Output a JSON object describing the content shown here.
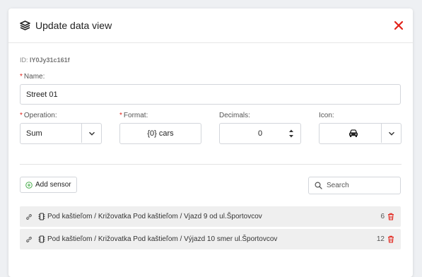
{
  "dialog": {
    "title": "Update data view",
    "id_label": "ID:",
    "id_value": "IY0Jy31c161f"
  },
  "form": {
    "name": {
      "label": "Name:",
      "required": "*",
      "value": "Street 01"
    },
    "operation": {
      "label": "Operation:",
      "required": "*",
      "value": "Sum"
    },
    "format": {
      "label": "Format:",
      "required": "*",
      "value": "{0} cars"
    },
    "decimals": {
      "label": "Decimals:",
      "value": "0"
    },
    "icon": {
      "label": "Icon:",
      "value_icon": "car-icon"
    }
  },
  "sensors_toolbar": {
    "add_label": "Add sensor",
    "search_placeholder": "Search"
  },
  "sensors": [
    {
      "name": "Pod kaštieľom / Križovatka Pod kaštieľom / Vjazd 9 od ul.Športovcov",
      "count": "6"
    },
    {
      "name": "Pod kaštieľom / Križovatka Pod kaštieľom / Výjazd 10 smer ul.Športovcov",
      "count": "12"
    }
  ],
  "colors": {
    "accent_red": "#e2231a",
    "add_green": "#4caf50",
    "row_bg": "#efefef"
  }
}
